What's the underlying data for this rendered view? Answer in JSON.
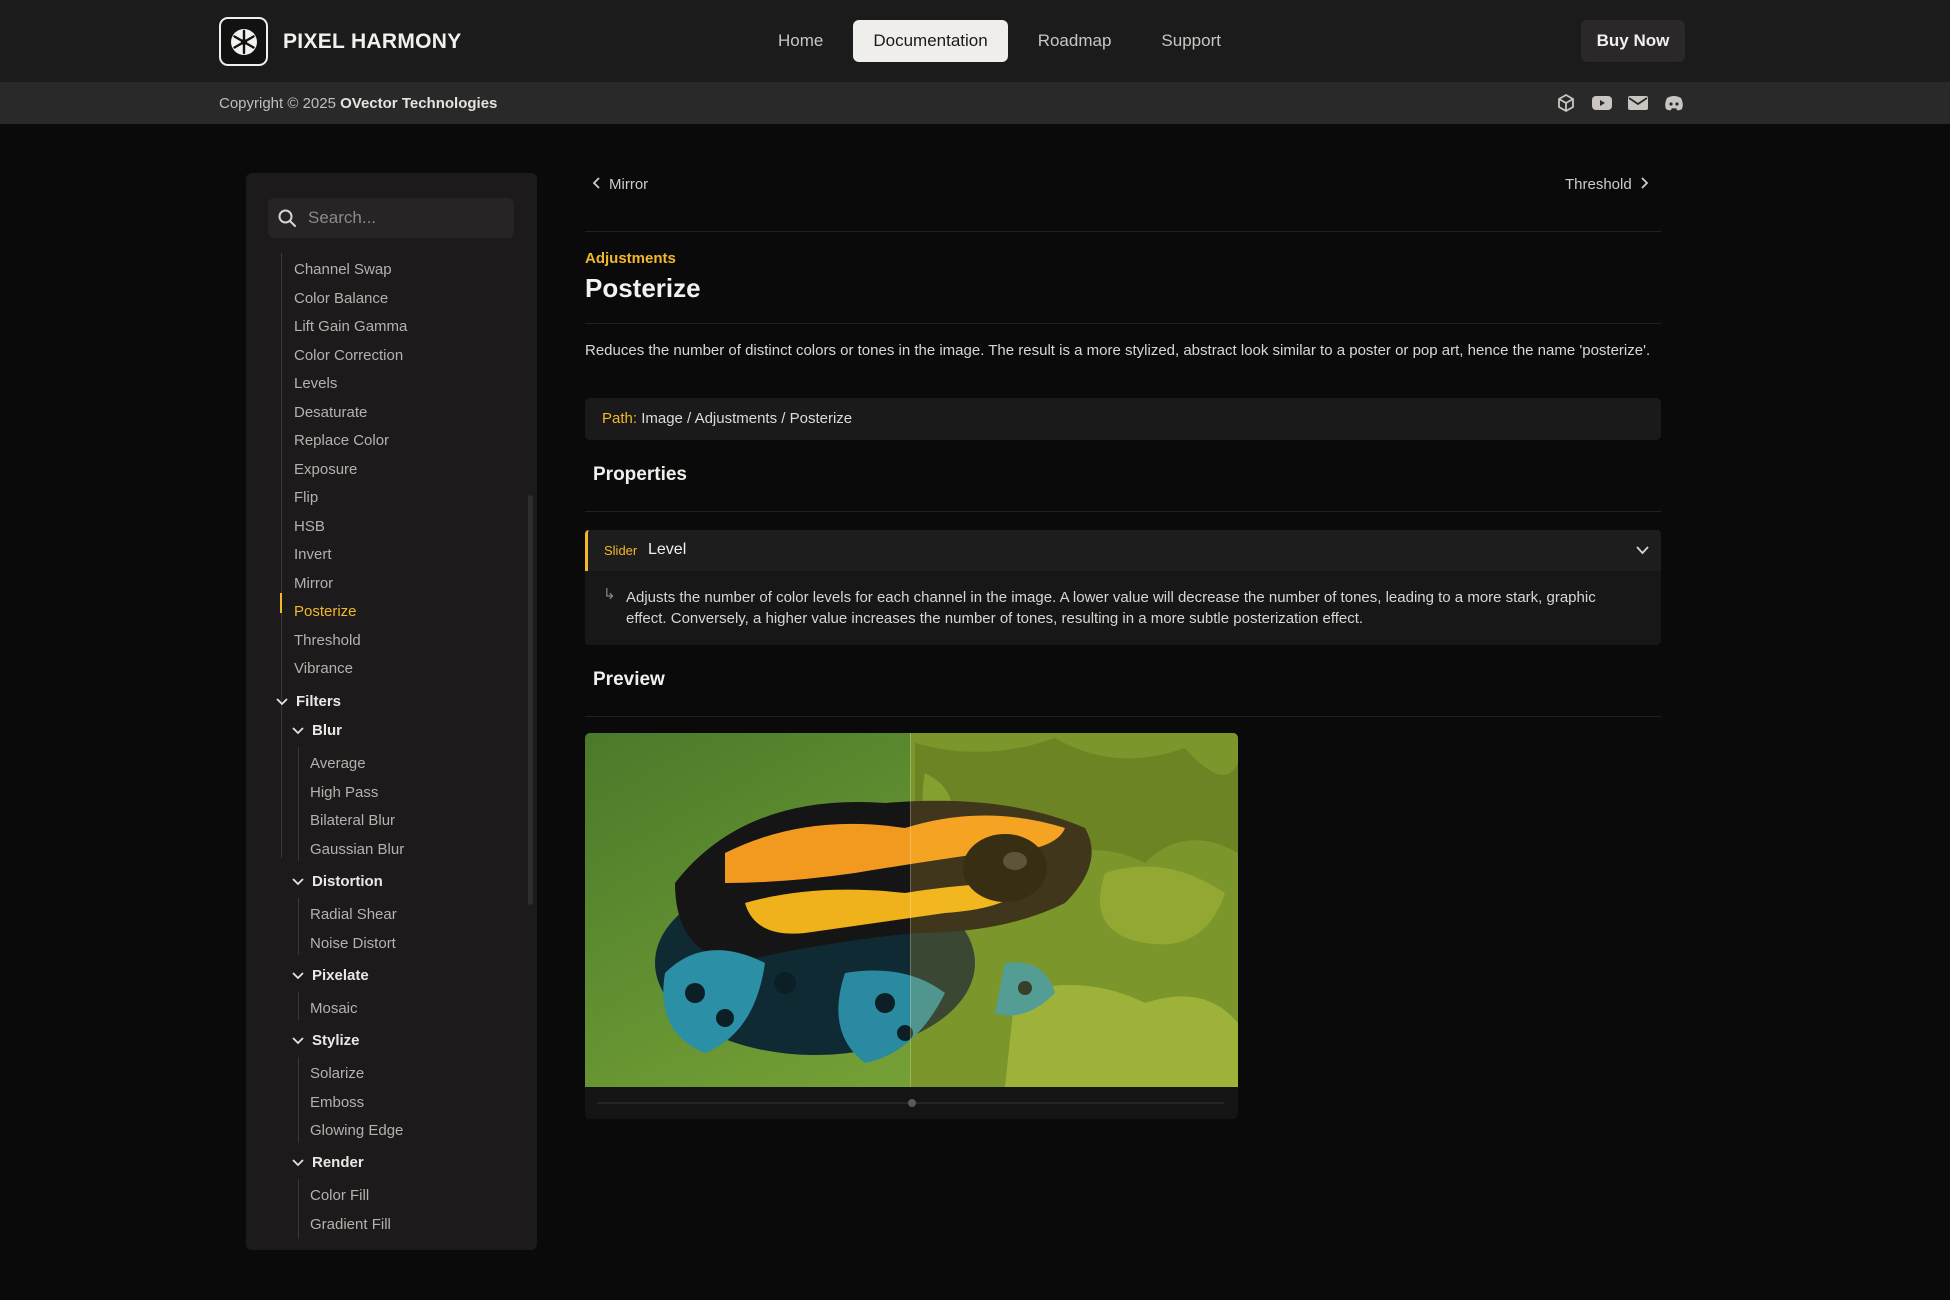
{
  "brand": {
    "name": "PIXEL HARMONY"
  },
  "nav": {
    "items": [
      "Home",
      "Documentation",
      "Roadmap",
      "Support"
    ],
    "active": "Documentation",
    "buy": "Buy Now"
  },
  "subbar": {
    "copyright_prefix": "Copyright © 2025 ",
    "company": "OVector Technologies",
    "social_icons": [
      "unity-icon",
      "youtube-icon",
      "mail-icon",
      "discord-icon"
    ]
  },
  "search": {
    "placeholder": "Search..."
  },
  "sidebar": {
    "adjustments": [
      "Channel Swap",
      "Color Balance",
      "Lift Gain Gamma",
      "Color Correction",
      "Levels",
      "Desaturate",
      "Replace Color",
      "Exposure",
      "Flip",
      "HSB",
      "Invert",
      "Mirror",
      "Posterize",
      "Threshold",
      "Vibrance"
    ],
    "active_item": "Posterize",
    "filters_label": "Filters",
    "blur_label": "Blur",
    "blur": [
      "Average",
      "High Pass",
      "Bilateral Blur",
      "Gaussian Blur"
    ],
    "distortion_label": "Distortion",
    "distortion": [
      "Radial Shear",
      "Noise Distort"
    ],
    "pixelate_label": "Pixelate",
    "pixelate": [
      "Mosaic"
    ],
    "stylize_label": "Stylize",
    "stylize": [
      "Solarize",
      "Emboss",
      "Glowing Edge"
    ],
    "render_label": "Render",
    "render": [
      "Color Fill",
      "Gradient Fill"
    ]
  },
  "pager": {
    "prev": "Mirror",
    "next": "Threshold"
  },
  "page": {
    "category": "Adjustments",
    "title": "Posterize",
    "description": "Reduces the number of distinct colors or tones in the image. The result is a more stylized, abstract look similar to a poster or pop art, hence the name 'posterize'.",
    "path_label": "Path:",
    "path": "Image / Adjustments / Posterize",
    "properties_heading": "Properties",
    "property": {
      "type": "Slider",
      "name": "Level",
      "description": "Adjusts the number of color levels for each channel in the image. A lower value will decrease the number of tones, leading to a more stark, graphic effect. Conversely, a higher value increases the number of tones, resulting in a more subtle posterization effect."
    },
    "preview_heading": "Preview",
    "preview_split": 0.5
  },
  "colors": {
    "accent": "#f2b72b",
    "background": "#0b0a0a",
    "panel": "#1c1a1a"
  }
}
